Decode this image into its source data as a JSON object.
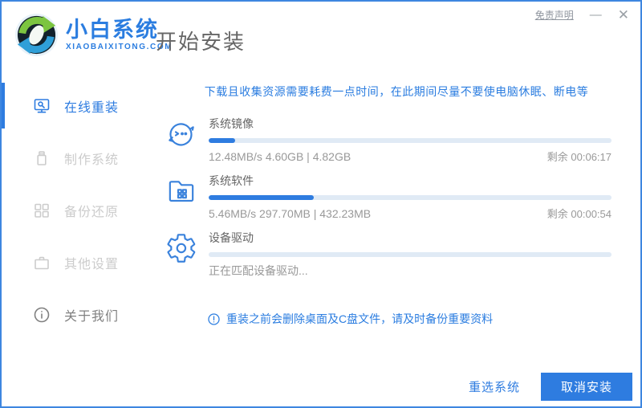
{
  "window": {
    "disclaimer": "免责声明",
    "minimize_glyph": "—",
    "close_glyph": "✕"
  },
  "brand": {
    "name": "小白系统",
    "domain": "XIAOBAIXITONG.COM"
  },
  "header": {
    "title": "开始安装"
  },
  "sidebar": {
    "items": [
      {
        "label": "在线重装",
        "icon": "monitor-search-icon",
        "active": true
      },
      {
        "label": "制作系统",
        "icon": "usb-drive-icon",
        "active": false
      },
      {
        "label": "备份还原",
        "icon": "backup-grid-icon",
        "active": false
      },
      {
        "label": "其他设置",
        "icon": "briefcase-icon",
        "active": false
      },
      {
        "label": "关于我们",
        "icon": "info-circle-icon",
        "active": false
      }
    ]
  },
  "main": {
    "notice": "下载且收集资源需要耗费一点时间，在此期间尽量不要使电脑休眠、断电等",
    "tasks": [
      {
        "name": "系统镜像",
        "icon": "mascot-face-icon",
        "progress_percent": 6.5,
        "status": "12.48MB/s 4.60GB | 4.82GB",
        "remaining": "剩余 00:06:17"
      },
      {
        "name": "系统软件",
        "icon": "folder-apps-icon",
        "progress_percent": 26,
        "status": "5.46MB/s 297.70MB | 432.23MB",
        "remaining": "剩余 00:00:54"
      },
      {
        "name": "设备驱动",
        "icon": "gear-icon",
        "progress_percent": 0,
        "status": "正在匹配设备驱动...",
        "remaining": ""
      }
    ],
    "warning": "重装之前会删除桌面及C盘文件，请及时备份重要资料"
  },
  "footer": {
    "reselect_label": "重选系统",
    "cancel_label": "取消安装"
  },
  "colors": {
    "accent": "#2e7ce0",
    "border": "#3e86e0",
    "progress_track": "#e0eaf5",
    "inactive_gray": "#cccccc"
  }
}
